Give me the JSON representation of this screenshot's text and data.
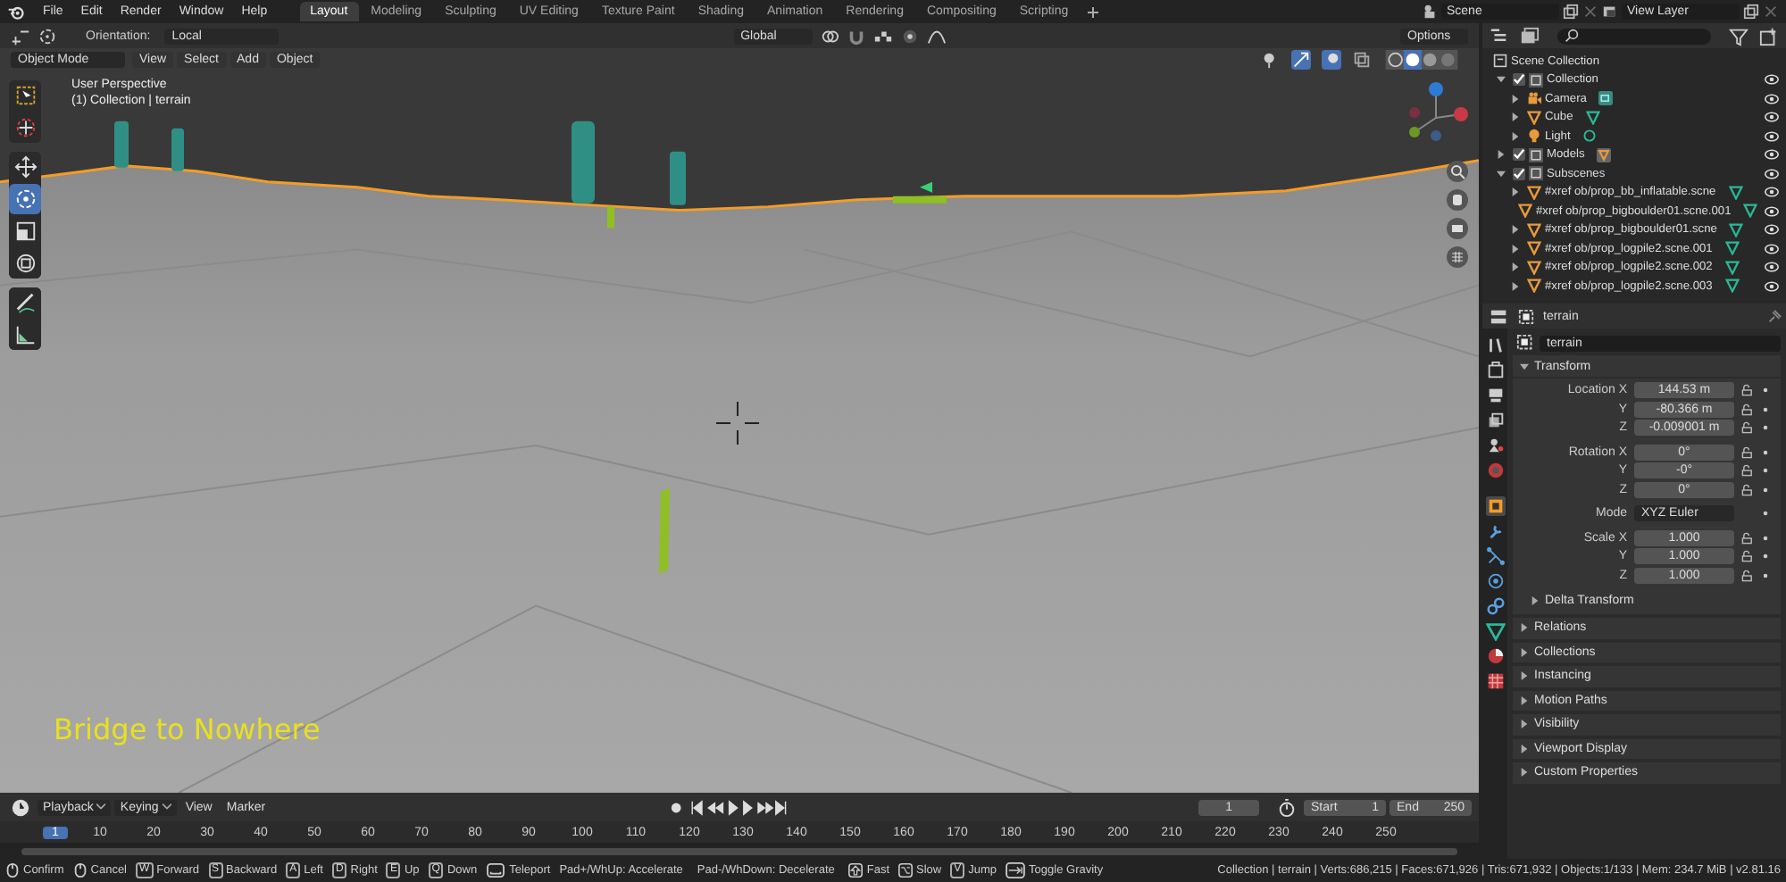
{
  "menu": [
    "File",
    "Edit",
    "Render",
    "Window",
    "Help"
  ],
  "workspaces": [
    {
      "label": "Layout",
      "selected": true
    },
    {
      "label": "Modeling",
      "selected": false
    },
    {
      "label": "Sculpting",
      "selected": false
    },
    {
      "label": "UV Editing",
      "selected": false
    },
    {
      "label": "Texture Paint",
      "selected": false
    },
    {
      "label": "Shading",
      "selected": false
    },
    {
      "label": "Animation",
      "selected": false
    },
    {
      "label": "Rendering",
      "selected": false
    },
    {
      "label": "Compositing",
      "selected": false
    },
    {
      "label": "Scripting",
      "selected": false
    }
  ],
  "scene": "Scene",
  "view_layer": "View Layer",
  "tool_header": {
    "orientation_label": "Orientation:",
    "orientation": "Local",
    "transform_orientation": "Global",
    "options": "Options"
  },
  "viewport_header": {
    "mode": "Object Mode",
    "menus": [
      "View",
      "Select",
      "Add",
      "Object"
    ]
  },
  "viewport": {
    "overlay_lines": [
      "User Perspective",
      "(1) Collection | terrain"
    ],
    "caption": "Bridge to Nowhere"
  },
  "tools": [
    {
      "kind": "select",
      "selected": false
    },
    {
      "kind": "cursor",
      "selected": false
    },
    {
      "kind": "move",
      "selected": false
    },
    {
      "kind": "rotate",
      "selected": true
    },
    {
      "kind": "scale",
      "selected": false
    },
    {
      "kind": "transform",
      "selected": false
    },
    {
      "kind": "annotate",
      "selected": false
    },
    {
      "kind": "measure",
      "selected": false
    }
  ],
  "outliner": {
    "root": "Scene Collection",
    "items": [
      {
        "label": "Collection",
        "kind": "collection",
        "checked": true,
        "expanded": true,
        "children": [
          {
            "label": "Camera",
            "kind": "camera"
          },
          {
            "label": "Cube",
            "kind": "mesh"
          },
          {
            "label": "Light",
            "kind": "light"
          }
        ]
      },
      {
        "label": "Models",
        "kind": "collection",
        "checked": true,
        "expanded": false
      },
      {
        "label": "Subscenes",
        "kind": "collection",
        "checked": true,
        "expanded": true,
        "children": [
          {
            "label": "#xref ob/prop_bb_inflatable.scne",
            "kind": "mesh"
          },
          {
            "label": "#xref ob/prop_bigboulder01.scne.001",
            "kind": "mesh"
          },
          {
            "label": "#xref ob/prop_bigboulder01.scne",
            "kind": "mesh"
          },
          {
            "label": "#xref ob/prop_logpile2.scne.001",
            "kind": "mesh"
          },
          {
            "label": "#xref ob/prop_logpile2.scne.002",
            "kind": "mesh"
          },
          {
            "label": "#xref ob/prop_logpile2.scne.003",
            "kind": "mesh"
          }
        ]
      }
    ]
  },
  "properties": {
    "object": "terrain",
    "name_field": "terrain",
    "tabs": [
      {
        "kind": "tool",
        "selected": false
      },
      {
        "kind": "render",
        "selected": false
      },
      {
        "kind": "output",
        "selected": false
      },
      {
        "kind": "view_layer",
        "selected": false
      },
      {
        "kind": "scene",
        "selected": false
      },
      {
        "kind": "world",
        "selected": false
      },
      {
        "kind": "object",
        "selected": true
      },
      {
        "kind": "modifier",
        "selected": false
      },
      {
        "kind": "particles",
        "selected": false
      },
      {
        "kind": "physics",
        "selected": false
      },
      {
        "kind": "constraint",
        "selected": false
      },
      {
        "kind": "data",
        "selected": false
      },
      {
        "kind": "material",
        "selected": false
      },
      {
        "kind": "texture",
        "selected": false
      }
    ],
    "transform_title": "Transform",
    "groups": [
      [
        {
          "label": "Location X",
          "value": "144.53 m",
          "kind": "number"
        },
        {
          "label": "Y",
          "value": "-80.366 m",
          "kind": "number"
        },
        {
          "label": "Z",
          "value": "-0.009001 m",
          "kind": "number"
        }
      ],
      [
        {
          "label": "Rotation X",
          "value": "0°",
          "kind": "number"
        },
        {
          "label": "Y",
          "value": "-0°",
          "kind": "number"
        },
        {
          "label": "Z",
          "value": "0°",
          "kind": "number"
        }
      ],
      [
        {
          "label": "Mode",
          "value": "XYZ Euler",
          "kind": "dropdown"
        }
      ],
      [
        {
          "label": "Scale X",
          "value": "1.000",
          "kind": "number"
        },
        {
          "label": "Y",
          "value": "1.000",
          "kind": "number"
        },
        {
          "label": "Z",
          "value": "1.000",
          "kind": "number"
        }
      ]
    ],
    "subpanel": "Delta Transform",
    "sections": [
      "Relations",
      "Collections",
      "Instancing",
      "Motion Paths",
      "Visibility",
      "Viewport Display",
      "Custom Properties"
    ]
  },
  "timeline": {
    "menus": [
      {
        "label": "Playback",
        "dropdown": true
      },
      {
        "label": "Keying",
        "dropdown": true
      },
      {
        "label": "View",
        "dropdown": false
      },
      {
        "label": "Marker",
        "dropdown": false
      }
    ],
    "current_frame": "1",
    "start_label": "Start",
    "start": "1",
    "end_label": "End",
    "end": "250",
    "ticks": [
      {
        "label": "1",
        "selected": true
      },
      {
        "label": "10",
        "selected": false
      },
      {
        "label": "20",
        "selected": false
      },
      {
        "label": "30",
        "selected": false
      },
      {
        "label": "40",
        "selected": false
      },
      {
        "label": "50",
        "selected": false
      },
      {
        "label": "60",
        "selected": false
      },
      {
        "label": "70",
        "selected": false
      },
      {
        "label": "80",
        "selected": false
      },
      {
        "label": "90",
        "selected": false
      },
      {
        "label": "100",
        "selected": false
      },
      {
        "label": "110",
        "selected": false
      },
      {
        "label": "120",
        "selected": false
      },
      {
        "label": "130",
        "selected": false
      },
      {
        "label": "140",
        "selected": false
      },
      {
        "label": "150",
        "selected": false
      },
      {
        "label": "160",
        "selected": false
      },
      {
        "label": "170",
        "selected": false
      },
      {
        "label": "180",
        "selected": false
      },
      {
        "label": "190",
        "selected": false
      },
      {
        "label": "200",
        "selected": false
      },
      {
        "label": "210",
        "selected": false
      },
      {
        "label": "220",
        "selected": false
      },
      {
        "label": "230",
        "selected": false
      },
      {
        "label": "240",
        "selected": false
      },
      {
        "label": "250",
        "selected": false
      }
    ]
  },
  "status_bar": {
    "hints": [
      {
        "kind": "mouse",
        "label": "Confirm"
      },
      {
        "kind": "mouse",
        "label": "Cancel"
      },
      {
        "kind": "key",
        "key": "W",
        "label": "Forward"
      },
      {
        "kind": "key",
        "key": "S",
        "label": "Backward"
      },
      {
        "kind": "key",
        "key": "A",
        "label": "Left"
      },
      {
        "kind": "key",
        "key": "D",
        "label": "Right"
      },
      {
        "kind": "key",
        "key": "E",
        "label": "Up"
      },
      {
        "kind": "key",
        "key": "Q",
        "label": "Down"
      },
      {
        "kind": "space",
        "label": "Teleport"
      },
      {
        "kind": "text",
        "label": "Pad+/WhUp: Accelerate"
      },
      {
        "kind": "text",
        "label": "Pad-/WhDown: Decelerate"
      },
      {
        "kind": "shift",
        "label": "Fast"
      },
      {
        "kind": "alt",
        "label": "Slow"
      },
      {
        "kind": "key",
        "key": "V",
        "label": "Jump"
      },
      {
        "kind": "tab",
        "label": "Toggle Gravity"
      }
    ],
    "stats": "Collection | terrain | Verts:686,215 | Faces:671,926 | Tris:671,932 | Objects:1/133 | Mem: 234.7 MiB | v2.81.16"
  }
}
